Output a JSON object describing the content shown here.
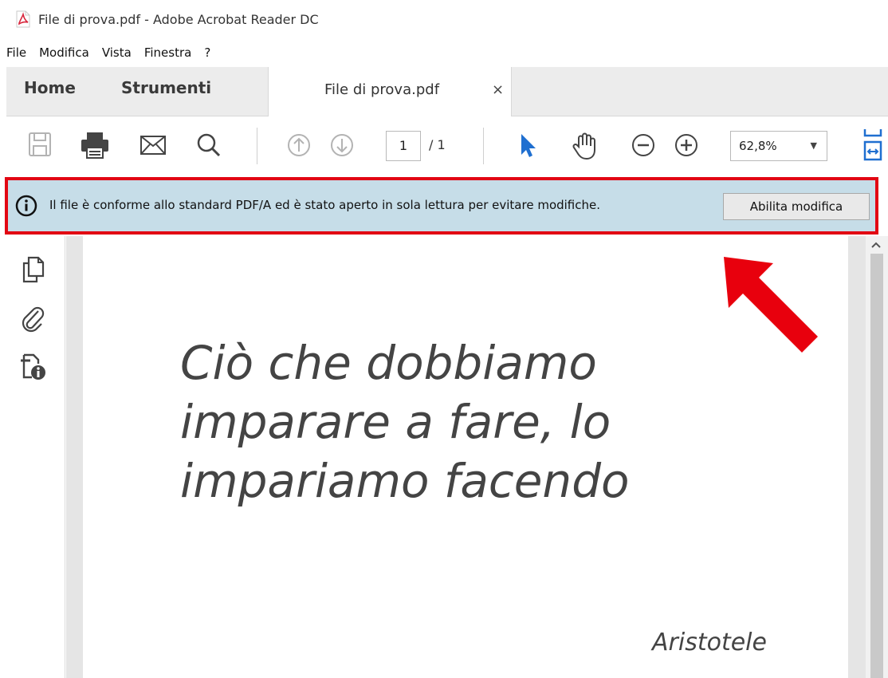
{
  "window": {
    "title": "File di prova.pdf - Adobe Acrobat Reader DC",
    "app_icon": "pdf-file-icon"
  },
  "menu": {
    "items": [
      "File",
      "Modifica",
      "Vista",
      "Finestra",
      "?"
    ]
  },
  "tabs": {
    "home": "Home",
    "tools": "Strumenti",
    "document": "File di prova.pdf",
    "close": "×"
  },
  "toolbar": {
    "icons": [
      "save-icon",
      "print-icon",
      "email-icon",
      "search-icon",
      "previous-page-icon",
      "next-page-icon",
      "select-cursor-icon",
      "hand-tool-icon",
      "zoom-out-icon",
      "zoom-in-icon",
      "fit-width-icon"
    ],
    "page_current": "1",
    "page_total": "/ 1",
    "zoom_value": "62,8%",
    "zoom_caret": "▼"
  },
  "infobar": {
    "message": "Il file è conforme allo standard PDF/A ed è stato aperto in sola lettura per evitare modifiche.",
    "button": "Abilita modifica",
    "highlight_color": "#e20613"
  },
  "sidebar": {
    "icons": [
      "page-thumbnails-icon",
      "attachments-icon",
      "document-info-icon"
    ]
  },
  "document": {
    "quote_lines": [
      "Ciò che dobbiamo",
      "imparare a fare, lo",
      "impariamo facendo"
    ],
    "author": "Aristotele"
  },
  "colors": {
    "accent_blue": "#1f6fd0",
    "annotation_red": "#e8000d",
    "infobar_bg": "#c6dde8"
  }
}
